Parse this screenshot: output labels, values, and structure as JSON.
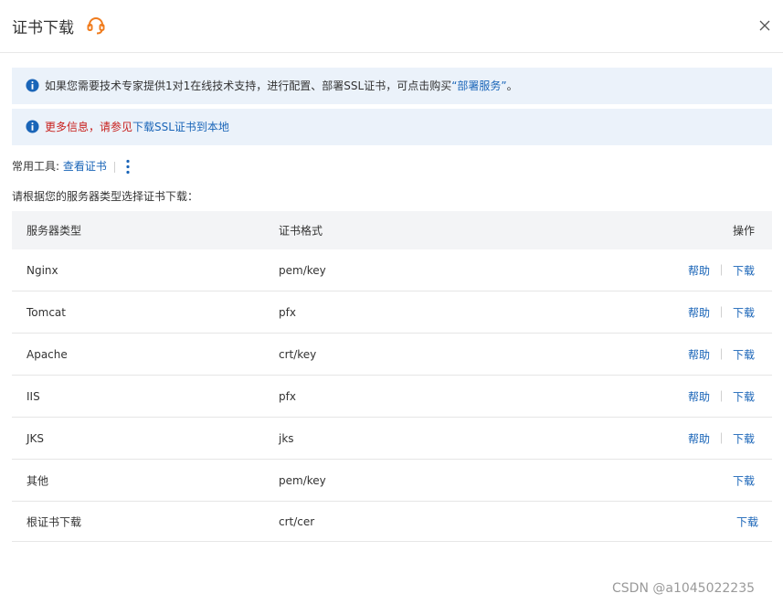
{
  "dialog": {
    "title": "证书下载",
    "support_icon": "headset-icon",
    "close_icon": "close-icon"
  },
  "notices": [
    {
      "icon": "info-icon",
      "text_before": "如果您需要技术专家提供1对1在线技术支持，进行配置、部署SSL证书，可点击购买",
      "link_text": "“部署服务”",
      "text_after": "。"
    },
    {
      "icon": "info-icon",
      "red_text": "更多信息，请参见",
      "link_text": "下载SSL证书到本地"
    }
  ],
  "tools": {
    "label": "常用工具:",
    "link": "查看证书",
    "more_icon": "more-vertical-icon"
  },
  "prompt": "请根据您的服务器类型选择证书下载：",
  "table": {
    "headers": [
      "服务器类型",
      "证书格式",
      "操作"
    ],
    "help_label": "帮助",
    "download_label": "下载",
    "rows": [
      {
        "server": "Nginx",
        "format": "pem/key",
        "has_help": true
      },
      {
        "server": "Tomcat",
        "format": "pfx",
        "has_help": true
      },
      {
        "server": "Apache",
        "format": "crt/key",
        "has_help": true
      },
      {
        "server": "IIS",
        "format": "pfx",
        "has_help": true
      },
      {
        "server": "JKS",
        "format": "jks",
        "has_help": true
      },
      {
        "server": "其他",
        "format": "pem/key",
        "has_help": false
      },
      {
        "server": "根证书下载",
        "format": "crt/cer",
        "has_help": false
      }
    ]
  },
  "watermark": "CSDN @a1045022235",
  "colors": {
    "accent": "#1a65b8",
    "notice_bg": "#ebf2fa",
    "warning_red": "#c8201d",
    "support_orange": "#f07c1e"
  }
}
